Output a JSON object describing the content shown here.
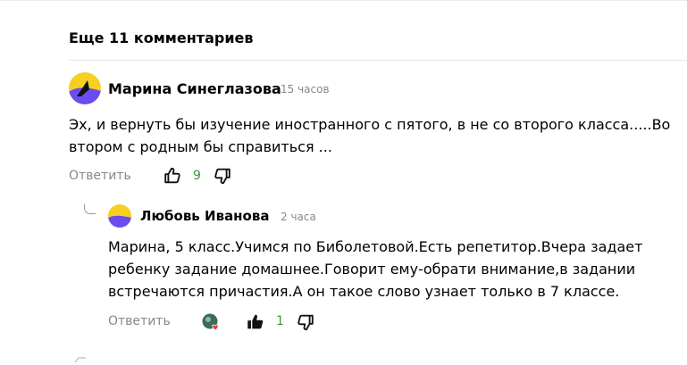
{
  "thread": {
    "more_comments_label": "Еще 11 комментариев"
  },
  "comments": [
    {
      "author": "Марина Синеглазова",
      "time": "15 часов",
      "text": "Эх, и вернуть бы изучение иностранного с пятого, в не со второго класса.....Во втором с родным бы справиться ...",
      "reply_label": "Ответить",
      "likes": "9",
      "like_icon": "thumb-up-outline-icon",
      "dislike_icon": "thumb-down-outline-icon"
    },
    {
      "author": "Любовь Иванова",
      "time": "2 часа",
      "text": "Марина, 5 класс.Учимся по Биболетовой.Есть репетитор.Вчера задает ребенку задание домашнее.Говорит ему-обрати внимание,в задании встречаются причастия.А он такое слово узнает только в 7 классе.",
      "reply_label": "Ответить",
      "likes": "1",
      "like_icon": "thumb-up-filled-icon",
      "dislike_icon": "thumb-down-outline-icon",
      "reaction_icon": "avatar-heart-reaction-icon"
    }
  ],
  "colors": {
    "likes_count": "#3a9a32",
    "muted_text": "#888888",
    "avatar_yellow": "#f5d020",
    "avatar_purple": "#6a4cf0"
  }
}
